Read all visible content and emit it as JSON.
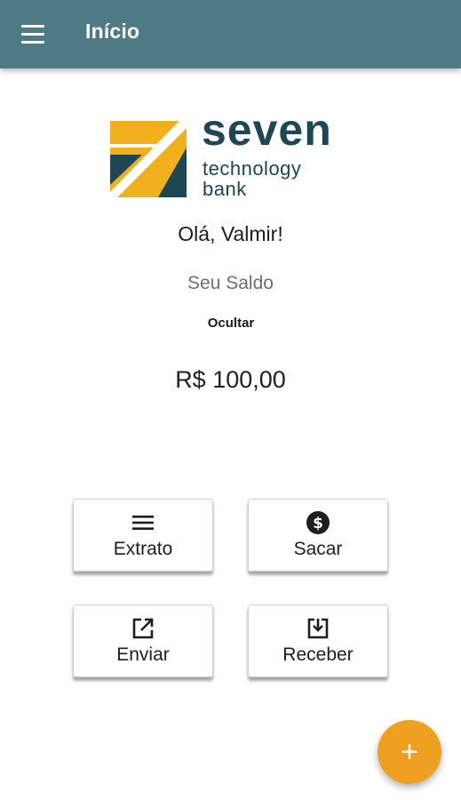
{
  "appbar": {
    "title": "Início",
    "background_color": "#4e7a86",
    "menu_icon": "hamburger-menu-icon"
  },
  "logo": {
    "word": "seven",
    "line1": "technology",
    "line2": "bank",
    "brand_colors": [
      "#f2b01e",
      "#1e4653"
    ]
  },
  "greeting": "Olá, Valmir!",
  "balance": {
    "label": "Seu Saldo",
    "hide_label": "Ocultar",
    "value": "R$ 100,00"
  },
  "actions": [
    {
      "label": "Extrato",
      "icon": "list-icon"
    },
    {
      "label": "Sacar",
      "icon": "dollar-coin-icon"
    },
    {
      "label": "Enviar",
      "icon": "send-external-icon"
    },
    {
      "label": "Receber",
      "icon": "download-tray-icon"
    }
  ],
  "fab": {
    "symbol": "+",
    "icon": "plus-icon",
    "color": "#f0a020"
  }
}
